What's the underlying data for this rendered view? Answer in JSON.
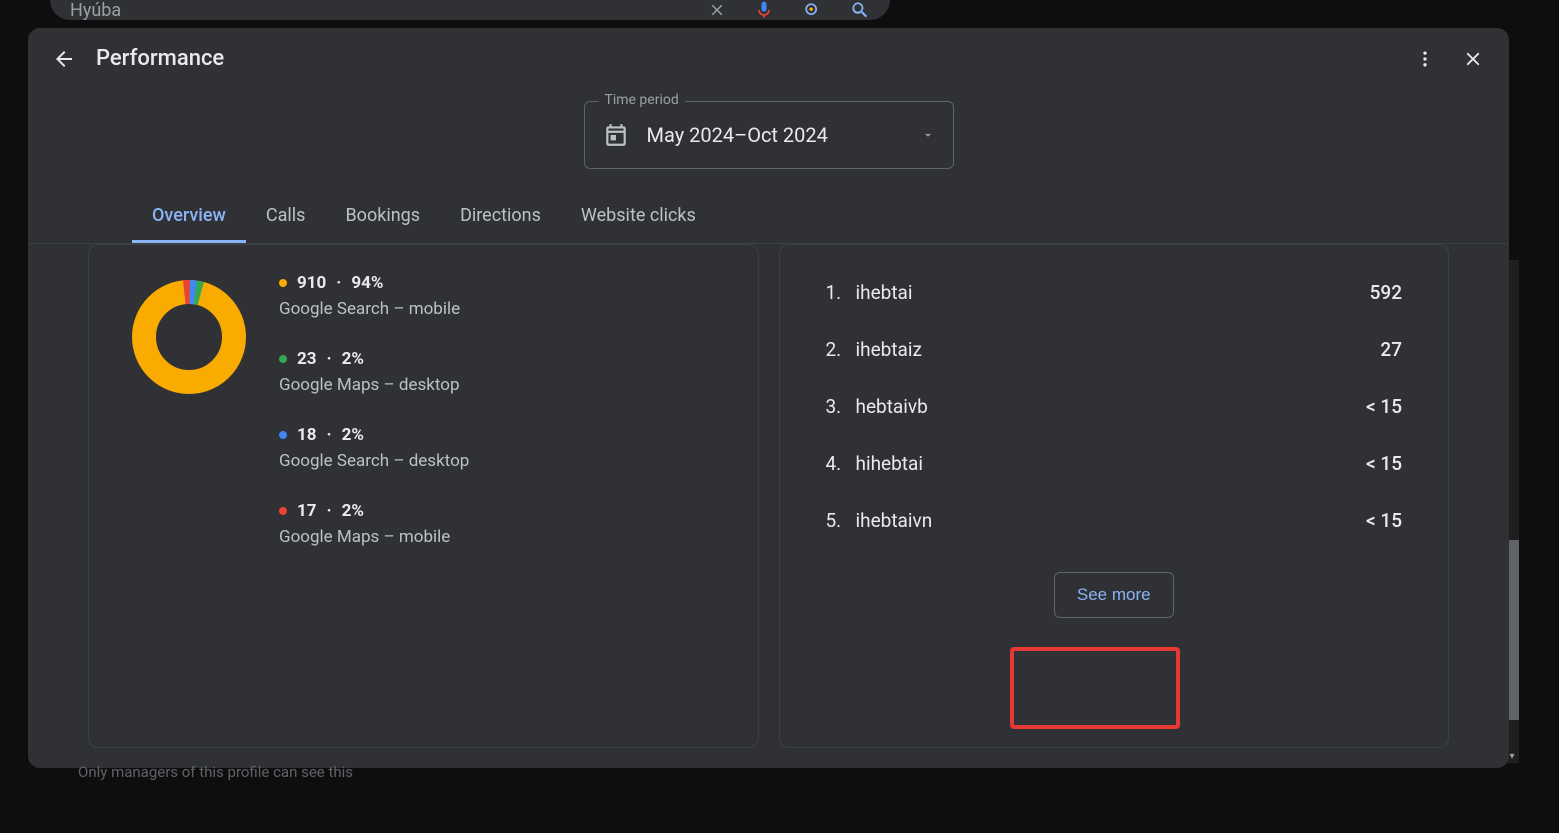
{
  "searchbar": {
    "query": "Hyúba"
  },
  "header": {
    "title": "Performance",
    "time_period_label": "Time period",
    "time_period_value": "May 2024–Oct 2024"
  },
  "tabs": [
    {
      "id": "overview",
      "label": "Overview",
      "active": true
    },
    {
      "id": "calls",
      "label": "Calls",
      "active": false
    },
    {
      "id": "bookings",
      "label": "Bookings",
      "active": false
    },
    {
      "id": "directions",
      "label": "Directions",
      "active": false
    },
    {
      "id": "website",
      "label": "Website clicks",
      "active": false
    }
  ],
  "breakdown": {
    "items": [
      {
        "color": "#f9ab00",
        "count": "910",
        "pct": "94%",
        "label": "Google Search – mobile"
      },
      {
        "color": "#34a853",
        "count": "23",
        "pct": "2%",
        "label": "Google Maps – desktop"
      },
      {
        "color": "#4285f4",
        "count": "18",
        "pct": "2%",
        "label": "Google Search – desktop"
      },
      {
        "color": "#ea4335",
        "count": "17",
        "pct": "2%",
        "label": "Google Maps – mobile"
      }
    ]
  },
  "chart_data": {
    "type": "pie",
    "title": "",
    "series": [
      {
        "name": "Google Search – mobile",
        "value": 910,
        "pct": 94,
        "color": "#f9ab00"
      },
      {
        "name": "Google Maps – desktop",
        "value": 23,
        "pct": 2,
        "color": "#34a853"
      },
      {
        "name": "Google Search – desktop",
        "value": 18,
        "pct": 2,
        "color": "#4285f4"
      },
      {
        "name": "Google Maps – mobile",
        "value": 17,
        "pct": 2,
        "color": "#ea4335"
      }
    ]
  },
  "searches": {
    "items": [
      {
        "rank": "1.",
        "term": "ihebtai",
        "value": "592"
      },
      {
        "rank": "2.",
        "term": "ihebtaiz",
        "value": "27"
      },
      {
        "rank": "3.",
        "term": "hebtaivb",
        "value": "< 15"
      },
      {
        "rank": "4.",
        "term": "hihebtai",
        "value": "< 15"
      },
      {
        "rank": "5.",
        "term": "ihebtaivn",
        "value": "< 15"
      }
    ],
    "see_more": "See more"
  },
  "footer": {
    "note": "Only managers of this profile can see this"
  }
}
